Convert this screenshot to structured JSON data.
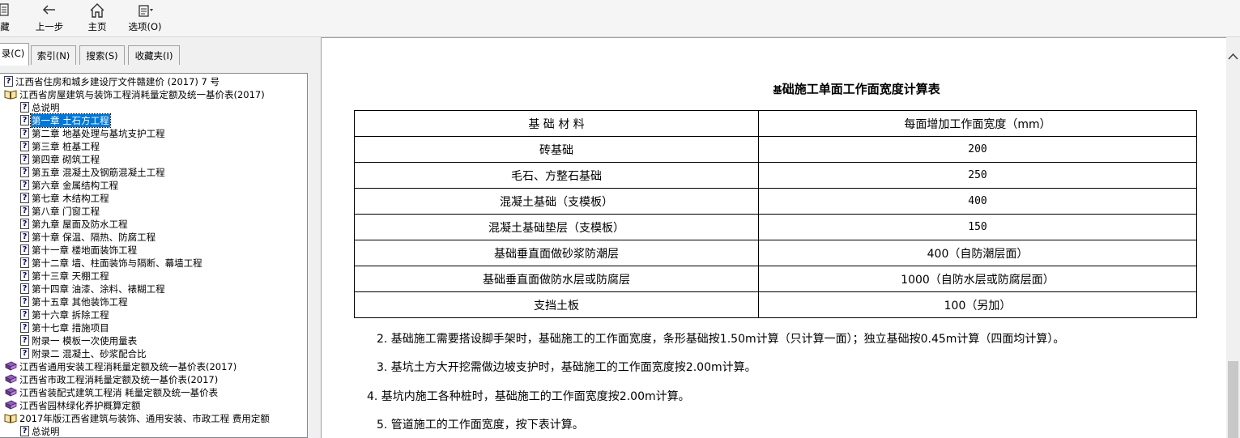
{
  "toolbar": {
    "items": [
      {
        "label": "藏",
        "icon": "bookmark-icon"
      },
      {
        "label": "上一步",
        "icon": "back-arrow-icon"
      },
      {
        "label": "主页",
        "icon": "home-icon"
      },
      {
        "label": "选项(O)",
        "icon": "options-icon"
      }
    ]
  },
  "tabs": [
    "录(C)",
    "索引(N)",
    "搜索(S)",
    "收藏夹(I)"
  ],
  "tree": [
    {
      "label": "江西省住房和城乡建设厅文件赣建价 (2017) 7 号",
      "icon": "help-page-icon",
      "level": 0
    },
    {
      "label": "江西省房屋建筑与装饰工程消耗量定额及统一基价表(2017)",
      "icon": "open-book-icon",
      "level": 0
    },
    {
      "label": "总说明",
      "icon": "help-page-icon",
      "level": 1
    },
    {
      "label": "第一章 土石方工程",
      "icon": "help-page-icon",
      "level": 1,
      "selected": true
    },
    {
      "label": "第二章 地基处理与基坑支护工程",
      "icon": "help-page-icon",
      "level": 1
    },
    {
      "label": "第三章 桩基工程",
      "icon": "help-page-icon",
      "level": 1
    },
    {
      "label": "第四章 砌筑工程",
      "icon": "help-page-icon",
      "level": 1
    },
    {
      "label": "第五章 混凝土及钢筋混凝土工程",
      "icon": "help-page-icon",
      "level": 1
    },
    {
      "label": "第六章 金属结构工程",
      "icon": "help-page-icon",
      "level": 1
    },
    {
      "label": "第七章 木结构工程",
      "icon": "help-page-icon",
      "level": 1
    },
    {
      "label": "第八章 门窗工程",
      "icon": "help-page-icon",
      "level": 1
    },
    {
      "label": "第九章 屋面及防水工程",
      "icon": "help-page-icon",
      "level": 1
    },
    {
      "label": "第十章 保温、隔热、防腐工程",
      "icon": "help-page-icon",
      "level": 1
    },
    {
      "label": "第十一章 楼地面装饰工程",
      "icon": "help-page-icon",
      "level": 1
    },
    {
      "label": "第十二章 墙、柱面装饰与隔断、幕墙工程",
      "icon": "help-page-icon",
      "level": 1
    },
    {
      "label": "第十三章 天棚工程",
      "icon": "help-page-icon",
      "level": 1
    },
    {
      "label": "第十四章 油漆、涂料、裱糊工程",
      "icon": "help-page-icon",
      "level": 1
    },
    {
      "label": "第十五章 其他装饰工程",
      "icon": "help-page-icon",
      "level": 1
    },
    {
      "label": "第十六章 拆除工程",
      "icon": "help-page-icon",
      "level": 1
    },
    {
      "label": "第十七章 措施项目",
      "icon": "help-page-icon",
      "level": 1
    },
    {
      "label": "附录一 模板一次使用量表",
      "icon": "help-page-icon",
      "level": 1
    },
    {
      "label": "附录二 混凝土、砂浆配合比",
      "icon": "help-page-icon",
      "level": 1
    },
    {
      "label": "江西省通用安装工程消耗量定额及统一基价表(2017)",
      "icon": "closed-book-icon",
      "level": 0
    },
    {
      "label": "江西省市政工程消耗量定额及统一基价表(2017)",
      "icon": "closed-book-icon",
      "level": 0
    },
    {
      "label": "江西省装配式建筑工程消 耗量定额及统一基价表",
      "icon": "closed-book-icon",
      "level": 0
    },
    {
      "label": "江西省园林绿化养护概算定额",
      "icon": "closed-book-icon",
      "level": 0
    },
    {
      "label": "2017年版江西省建筑与装饰、通用安装、市政工程 费用定额",
      "icon": "open-book-icon",
      "level": 0
    },
    {
      "label": "总说明",
      "icon": "help-page-icon",
      "level": 1
    }
  ],
  "content": {
    "title_prefix": "基",
    "title_rest": "础施工单面工作面宽度计算表",
    "table": {
      "headers": [
        "基 础 材 料",
        "每面增加工作面宽度（mm）"
      ],
      "rows": [
        [
          "砖基础",
          "200"
        ],
        [
          "毛石、方整石基础",
          "250"
        ],
        [
          "混凝土基础（支模板）",
          "400"
        ],
        [
          "混凝土基础垫层（支模板）",
          "150"
        ],
        [
          "基础垂直面做砂浆防潮层",
          "400（自防潮层面）"
        ],
        [
          "基础垂直面做防水层或防腐层",
          "1000（自防水层或防腐层面）"
        ],
        [
          "支挡土板",
          "100（另加）"
        ]
      ]
    },
    "paragraphs": [
      "2. 基础施工需要搭设脚手架时，基础施工的工作面宽度，条形基础按1.50m计算（只计算一面）；独立基础按0.45m计算（四面均计算）。",
      "3. 基坑土方大开挖需做边坡支护时，基础施工的工作面宽度按2.00m计算。",
      "4. 基坑内施工各种桩时，基础施工的工作面宽度按2.00m计算。",
      "5. 管道施工的工作面宽度，按下表计算。"
    ]
  }
}
